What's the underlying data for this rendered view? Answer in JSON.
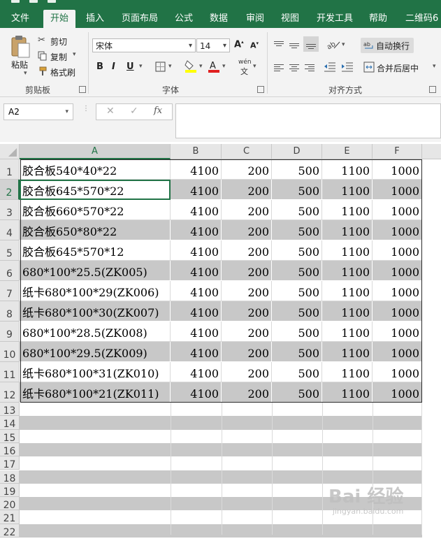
{
  "ribbon_tabs": [
    "文件",
    "开始",
    "插入",
    "页面布局",
    "公式",
    "数据",
    "审阅",
    "视图",
    "开发工具",
    "帮助",
    "二维码6"
  ],
  "active_tab": "开始",
  "clipboard": {
    "paste": "粘贴",
    "cut": "剪切",
    "copy": "复制",
    "format_painter": "格式刷",
    "group": "剪贴板"
  },
  "font": {
    "name": "宋体",
    "size": "14",
    "bold": "B",
    "italic": "I",
    "underline": "U",
    "grow": "A",
    "shrink": "A",
    "phonetic": "wén",
    "group": "字体"
  },
  "alignment": {
    "wrap_text": "自动换行",
    "merge_center": "合并后居中",
    "group": "对齐方式"
  },
  "formula_bar": {
    "name_box": "A2",
    "cancel": "✕",
    "enter": "✓",
    "fx": "fx",
    "value": ""
  },
  "columns": [
    "A",
    "B",
    "C",
    "D",
    "E",
    "F"
  ],
  "rows": [
    {
      "n": "1",
      "a": "胶合板540*40*22",
      "b": "4100",
      "c": "200",
      "d": "500",
      "e": "1100",
      "f": "1000"
    },
    {
      "n": "2",
      "a": "胶合板645*570*22",
      "b": "4100",
      "c": "200",
      "d": "500",
      "e": "1100",
      "f": "1000"
    },
    {
      "n": "3",
      "a": "胶合板660*570*22",
      "b": "4100",
      "c": "200",
      "d": "500",
      "e": "1100",
      "f": "1000"
    },
    {
      "n": "4",
      "a": "胶合板650*80*22",
      "b": "4100",
      "c": "200",
      "d": "500",
      "e": "1100",
      "f": "1000"
    },
    {
      "n": "5",
      "a": "胶合板645*570*12",
      "b": "4100",
      "c": "200",
      "d": "500",
      "e": "1100",
      "f": "1000"
    },
    {
      "n": "6",
      "a": "680*100*25.5(ZK005)",
      "b": "4100",
      "c": "200",
      "d": "500",
      "e": "1100",
      "f": "1000"
    },
    {
      "n": "7",
      "a": "纸卡680*100*29(ZK006)",
      "b": "4100",
      "c": "200",
      "d": "500",
      "e": "1100",
      "f": "1000"
    },
    {
      "n": "8",
      "a": "纸卡680*100*30(ZK007)",
      "b": "4100",
      "c": "200",
      "d": "500",
      "e": "1100",
      "f": "1000"
    },
    {
      "n": "9",
      "a": "680*100*28.5(ZK008)",
      "b": "4100",
      "c": "200",
      "d": "500",
      "e": "1100",
      "f": "1000"
    },
    {
      "n": "10",
      "a": "680*100*29.5(ZK009)",
      "b": "4100",
      "c": "200",
      "d": "500",
      "e": "1100",
      "f": "1000"
    },
    {
      "n": "11",
      "a": "纸卡680*100*31(ZK010)",
      "b": "4100",
      "c": "200",
      "d": "500",
      "e": "1100",
      "f": "1000"
    },
    {
      "n": "12",
      "a": "纸卡680*100*21(ZK011)",
      "b": "4100",
      "c": "200",
      "d": "500",
      "e": "1100",
      "f": "1000"
    }
  ],
  "empty_rows": [
    "13",
    "14",
    "15",
    "16",
    "17",
    "18",
    "19",
    "20",
    "21",
    "22"
  ],
  "watermark": {
    "brand": "Bai 经验",
    "url": "jingyan.baidu.com"
  },
  "colors": {
    "accent": "#217346",
    "band": "#c8c8c8"
  }
}
